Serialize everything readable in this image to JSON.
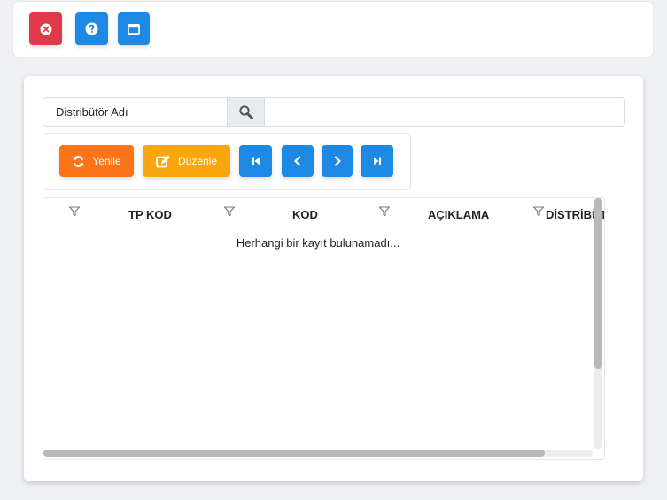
{
  "topbar": {
    "buttons": [
      {
        "name": "close",
        "icon": "close-circle-icon",
        "color": "#e0394a"
      },
      {
        "name": "help",
        "icon": "question-circle-icon",
        "color": "#1e88e5"
      },
      {
        "name": "window",
        "icon": "window-icon",
        "color": "#1e88e5"
      }
    ]
  },
  "search": {
    "label": "Distribütör Adı",
    "icon": "search-icon",
    "value": ""
  },
  "toolbar": {
    "refresh_label": "Yenile",
    "edit_label": "Düzenle",
    "refresh_color": "#fb7418",
    "edit_color": "#fba50f",
    "nav_color": "#1e88e5",
    "nav_icons": [
      "first-page-icon",
      "prev-page-icon",
      "next-page-icon",
      "last-page-icon"
    ]
  },
  "grid": {
    "columns": [
      "TP KOD",
      "KOD",
      "AÇIKLAMA",
      "DİSTRİBÜTÖR"
    ],
    "empty_message": "Herhangi bir kayıt bulunamadı..."
  }
}
